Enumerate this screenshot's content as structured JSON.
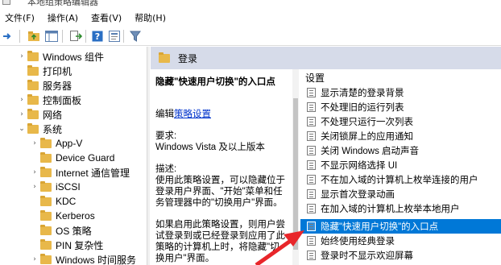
{
  "window": {
    "title": "本地组策略编辑器"
  },
  "menu": [
    {
      "label": "文件(F)"
    },
    {
      "label": "操作(A)"
    },
    {
      "label": "查看(V)"
    },
    {
      "label": "帮助(H)"
    }
  ],
  "toolbar": {
    "buttons": [
      "back-icon",
      "forward-icon",
      "up-folder-icon",
      "show-hide-tree-icon",
      "export-list-icon",
      "help-icon",
      "properties-icon",
      "filter-icon"
    ]
  },
  "tree": {
    "items": [
      {
        "label": "Windows 组件",
        "expander": "›",
        "indent": 0
      },
      {
        "label": "打印机",
        "expander": "",
        "indent": 0
      },
      {
        "label": "服务器",
        "expander": "",
        "indent": 0
      },
      {
        "label": "控制面板",
        "expander": "›",
        "indent": 0
      },
      {
        "label": "网络",
        "expander": "›",
        "indent": 0
      },
      {
        "label": "系统",
        "expander": "⌄",
        "indent": 0
      },
      {
        "label": "App-V",
        "expander": "›",
        "indent": 1
      },
      {
        "label": "Device Guard",
        "expander": "",
        "indent": 1
      },
      {
        "label": "Internet 通信管理",
        "expander": "›",
        "indent": 1
      },
      {
        "label": "iSCSI",
        "expander": "›",
        "indent": 1
      },
      {
        "label": "KDC",
        "expander": "",
        "indent": 1
      },
      {
        "label": "Kerberos",
        "expander": "",
        "indent": 1
      },
      {
        "label": "OS 策略",
        "expander": "",
        "indent": 1
      },
      {
        "label": "PIN 复杂性",
        "expander": "",
        "indent": 1
      },
      {
        "label": "Windows 时间服务",
        "expander": "›",
        "indent": 1
      }
    ]
  },
  "content": {
    "header_title": "登录",
    "description": {
      "title": "隐藏\"快速用户切换\"的入口点",
      "edit_prefix": "编辑",
      "edit_link": "策略设置",
      "requirements_label": "要求:",
      "requirements_value": "Windows Vista 及以上版本",
      "description_label": "描述:",
      "description_text": "使用此策略设置，可以隐藏位于登录用户界面、\"开始\"菜单和任务管理器中的\"切换用户\"界面。",
      "enabled_text": "如果启用此策略设置，则用户尝试登录到或已经登录到应用了此策略的计算机上时，将隐藏\"切换用户\"界面。"
    },
    "settings": {
      "column_header": "设置",
      "items": [
        {
          "label": "显示清楚的登录背景",
          "selected": false
        },
        {
          "label": "不处理旧的运行列表",
          "selected": false
        },
        {
          "label": "不处理只运行一次列表",
          "selected": false
        },
        {
          "label": "关闭锁屏上的应用通知",
          "selected": false
        },
        {
          "label": "关闭 Windows 启动声音",
          "selected": false
        },
        {
          "label": "不显示网络选择 UI",
          "selected": false
        },
        {
          "label": "不在加入域的计算机上枚举连接的用户",
          "selected": false
        },
        {
          "label": "显示首次登录动画",
          "selected": false
        },
        {
          "label": "在加入域的计算机上枚举本地用户",
          "selected": false
        },
        {
          "label": "隐藏\"快速用户切换\"的入口点",
          "selected": true
        },
        {
          "label": "始终使用经典登录",
          "selected": false
        },
        {
          "label": "登录时不显示欢迎屏幕",
          "selected": false
        }
      ]
    }
  },
  "colors": {
    "selection": "#0078d7",
    "header_band": "#d6dbe9",
    "folder": "#e8b84a",
    "link": "#0033cc",
    "annotation_arrow": "#e8262a"
  }
}
